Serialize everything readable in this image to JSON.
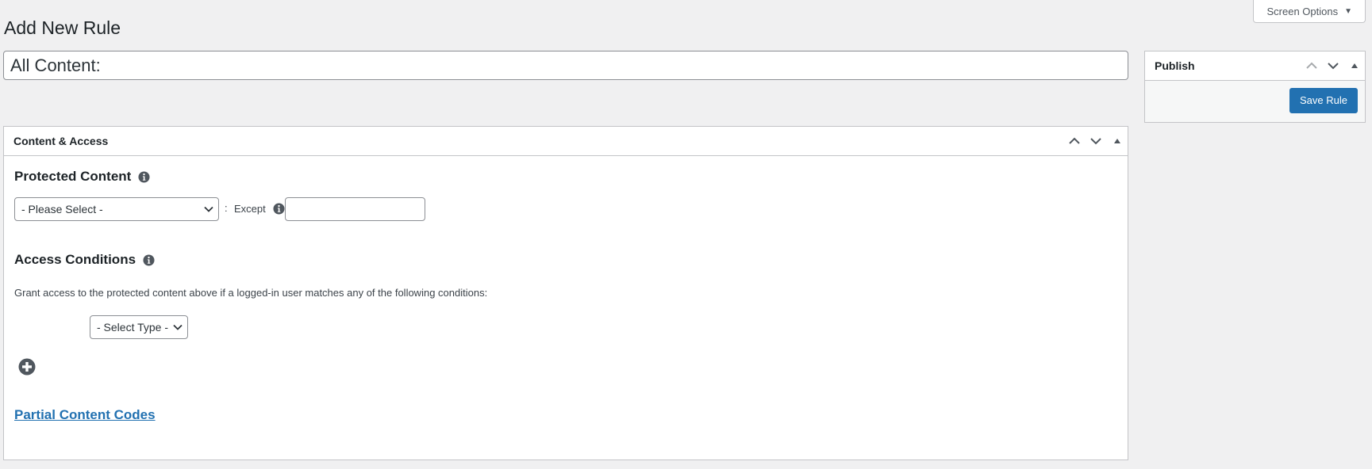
{
  "screen_options": {
    "label": "Screen Options"
  },
  "page": {
    "title": "Add New Rule"
  },
  "rule_title": {
    "value": "All Content:"
  },
  "publish": {
    "title": "Publish",
    "save_label": "Save Rule"
  },
  "content_access": {
    "title": "Content & Access",
    "protected_content": {
      "heading": "Protected Content",
      "select_value": "- Please Select -",
      "except_label": "Except",
      "except_value": ""
    },
    "access_conditions": {
      "heading": "Access Conditions",
      "description": "Grant access to the protected content above if a logged-in user matches any of the following conditions:",
      "type_select_value": "- Select Type -"
    },
    "partial_codes_link": "Partial Content Codes"
  },
  "icons": {
    "move_up": "chevron-up-icon",
    "move_down": "chevron-down-icon",
    "toggle": "triangle-up-icon",
    "info": "info-icon",
    "add": "plus-circle-icon"
  },
  "colors": {
    "accent": "#2271b1",
    "background": "#f0f0f1",
    "border": "#c3c4c7"
  }
}
